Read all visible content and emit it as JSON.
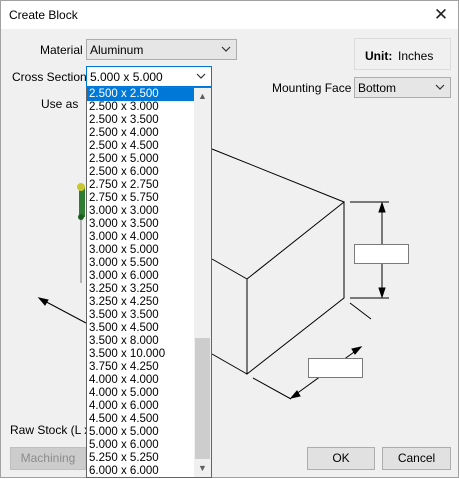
{
  "window": {
    "title": "Create Block"
  },
  "material": {
    "label": "Material",
    "value": "Aluminum"
  },
  "cross_section": {
    "label": "Cross Section",
    "value": "5.000 x 5.000",
    "options": [
      "2.500 x 2.500",
      "2.500 x 3.000",
      "2.500 x 3.500",
      "2.500 x 4.000",
      "2.500 x 4.500",
      "2.500 x 5.000",
      "2.500 x 6.000",
      "2.750 x 2.750",
      "2.750 x 5.750",
      "3.000 x 3.000",
      "3.000 x 3.500",
      "3.000 x 4.000",
      "3.000 x 5.000",
      "3.000 x 5.500",
      "3.000 x 6.000",
      "3.250 x 3.250",
      "3.250 x 4.250",
      "3.500 x 3.500",
      "3.500 x 4.500",
      "3.500 x 8.000",
      "3.500 x 10.000",
      "3.750 x 4.250",
      "4.000 x 4.000",
      "4.000 x 5.000",
      "4.000 x 6.000",
      "4.500 x 4.500",
      "5.000 x 5.000",
      "5.000 x 6.000",
      "5.250 x 5.250",
      "6.000 x 6.000"
    ],
    "highlighted_index": 0
  },
  "use_as": {
    "label": "Use as"
  },
  "unit": {
    "label": "Unit:",
    "value": "Inches"
  },
  "mounting_face": {
    "label": "Mounting Face",
    "value": "Bottom"
  },
  "raw_stock": {
    "label": "Raw Stock (L x"
  },
  "buttons": {
    "machining": "Machining",
    "ok": "OK",
    "cancel": "Cancel"
  },
  "icons": {
    "close": "close-icon",
    "dropdown": "chevron-down-icon",
    "scroll_up": "scroll-up-arrow-icon",
    "scroll_down": "scroll-down-arrow-icon"
  }
}
